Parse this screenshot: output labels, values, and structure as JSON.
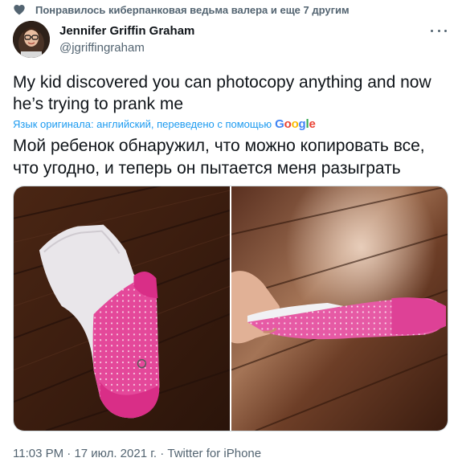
{
  "social_context": {
    "text": "Понравилось киберпанковая ведьма валера и еще 7 другим",
    "icon": "heart-icon"
  },
  "author": {
    "name": "Jennifer Griffin Graham",
    "handle": "@jgriffingraham"
  },
  "menu": {
    "icon": "more-options-icon"
  },
  "tweet": {
    "text": "My kid discovered you can photocopy anything and now he’s trying to prank me",
    "translation_label": "Язык оригинала: английский, переведено с помощью",
    "translation_provider": "Google",
    "translated_text": "Мой ребенок обнаружил, что можно копировать все, что угодно, и теперь он пытается меня разыграть"
  },
  "media": {
    "photos": [
      {
        "description": "sock-on-floor"
      },
      {
        "description": "hand-holding-paper-sock"
      }
    ]
  },
  "meta": {
    "time": "11:03 PM",
    "separator": "·",
    "date": "17 июл. 2021 г.",
    "source": "Twitter for iPhone"
  },
  "colors": {
    "link_blue": "#1d9bf0",
    "secondary_text": "#536471",
    "primary_text": "#0f1419",
    "google_blue": "#4285f4",
    "google_red": "#ea4335",
    "google_yellow": "#fbbc05",
    "google_green": "#34a853"
  }
}
